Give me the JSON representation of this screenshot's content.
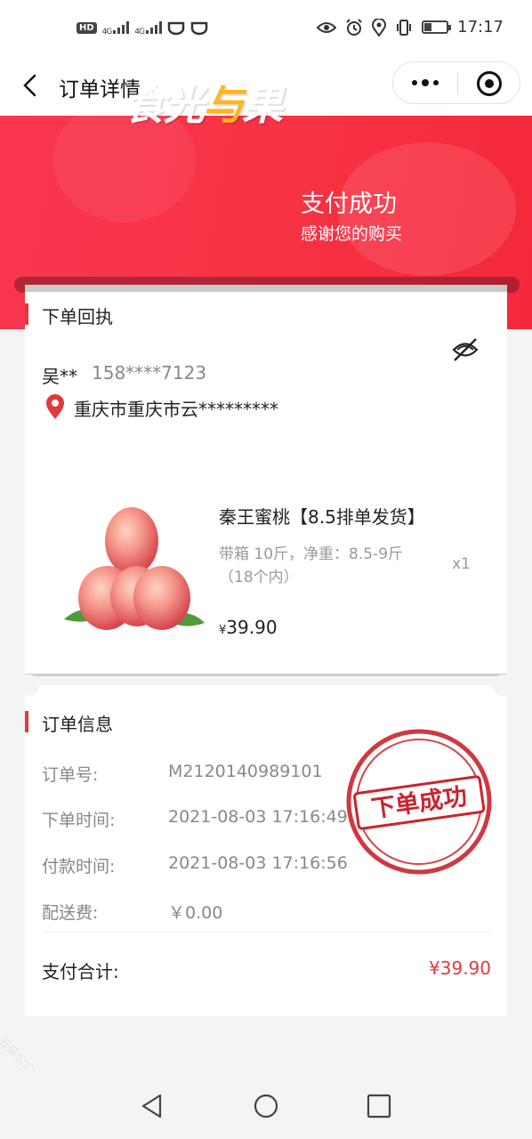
{
  "status_bar": {
    "left_icons": [
      "hd-icon",
      "signal-4g-icon",
      "signal-4g-icon",
      "app-icon",
      "app-icon"
    ],
    "network_1": "4G",
    "network_2": "4G",
    "hd": "HD",
    "right_icons": [
      "eye-icon",
      "alarm-icon",
      "location-icon",
      "vibrate-icon",
      "battery-icon"
    ],
    "battery_level": 0.3,
    "time": "17:17"
  },
  "nav": {
    "title": "订单详情"
  },
  "banner": {
    "brand_part1": "食光",
    "brand_part2": "与",
    "brand_part3": "果",
    "pay_title": "支付成功",
    "pay_subtitle": "感谢您的购买",
    "colors": {
      "banner": "#f73345",
      "brand_accent": "#ffb51f"
    }
  },
  "receipt": {
    "section_title": "下单回执",
    "customer_name": "吴**",
    "customer_phone": "158****7123",
    "address": "重庆市重庆市云*********",
    "product": {
      "name": "秦王蜜桃【8.5排单发货】",
      "spec": "带箱 10斤，净重：8.5-9斤（18个内）",
      "qty": "x1",
      "currency": "¥",
      "price": "39.90"
    }
  },
  "order_info": {
    "section_title": "订单信息",
    "rows": [
      {
        "label": "订单号:",
        "value": "M2120140989101"
      },
      {
        "label": "下单时间:",
        "value": "2021-08-03 17:16:49"
      },
      {
        "label": "付款时间:",
        "value": "2021-08-03 17:16:56"
      },
      {
        "label": "配送费:",
        "value": "￥0.00"
      }
    ],
    "total_label": "支付合计:",
    "total_value": "¥39.90",
    "stamp_text": "下单成功",
    "accent_color": "#e23a3a"
  },
  "watermark": "云朵公众号 yunduo.com"
}
